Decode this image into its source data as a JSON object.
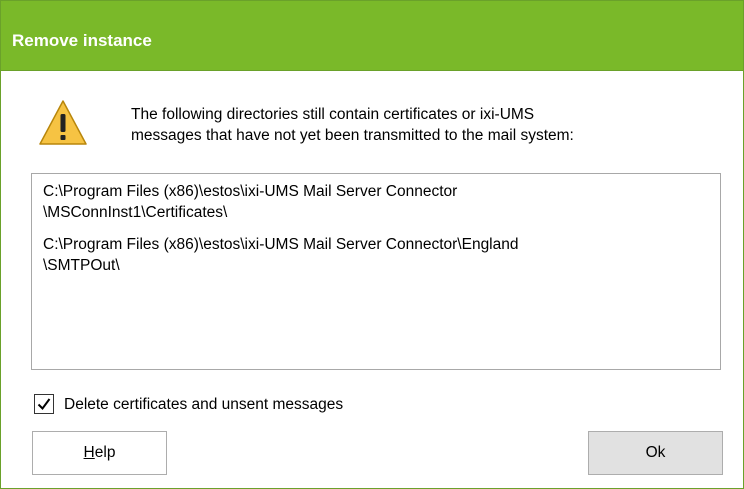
{
  "dialog": {
    "title": "Remove instance",
    "icon": "warning-icon",
    "message": [
      "The following directories still contain certificates or ixi-UMS",
      "messages that have not yet been transmitted to the mail system:"
    ],
    "directories": [
      [
        "C:\\Program Files (x86)\\estos\\ixi-UMS Mail Server Connector",
        "\\MSConnInst1\\Certificates\\"
      ],
      [
        "C:\\Program Files (x86)\\estos\\ixi-UMS Mail Server Connector\\England",
        "\\SMTPOut\\"
      ]
    ],
    "checkbox": {
      "label": "Delete certificates and unsent messages",
      "checked": true
    },
    "buttons": {
      "help_mnemonic": "H",
      "help_rest": "elp",
      "ok_label": "Ok"
    },
    "colors": {
      "titlebar": "#7ab929",
      "warning": "#f6c343"
    }
  }
}
